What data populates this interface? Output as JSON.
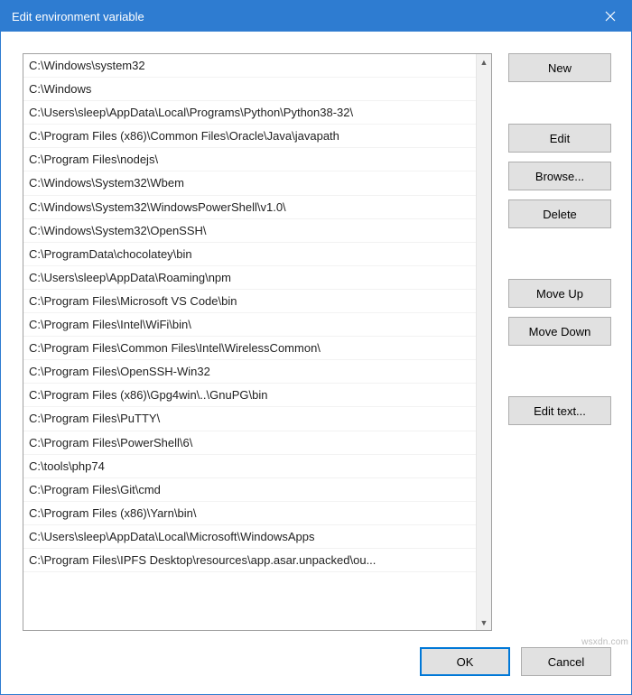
{
  "window": {
    "title": "Edit environment variable"
  },
  "list": {
    "items": [
      "C:\\Windows\\system32",
      "C:\\Windows",
      "C:\\Users\\sleep\\AppData\\Local\\Programs\\Python\\Python38-32\\",
      "C:\\Program Files (x86)\\Common Files\\Oracle\\Java\\javapath",
      "C:\\Program Files\\nodejs\\",
      "C:\\Windows\\System32\\Wbem",
      "C:\\Windows\\System32\\WindowsPowerShell\\v1.0\\",
      "C:\\Windows\\System32\\OpenSSH\\",
      "C:\\ProgramData\\chocolatey\\bin",
      "C:\\Users\\sleep\\AppData\\Roaming\\npm",
      "C:\\Program Files\\Microsoft VS Code\\bin",
      "C:\\Program Files\\Intel\\WiFi\\bin\\",
      "C:\\Program Files\\Common Files\\Intel\\WirelessCommon\\",
      "C:\\Program Files\\OpenSSH-Win32",
      "C:\\Program Files (x86)\\Gpg4win\\..\\GnuPG\\bin",
      "C:\\Program Files\\PuTTY\\",
      "C:\\Program Files\\PowerShell\\6\\",
      "C:\\tools\\php74",
      "C:\\Program Files\\Git\\cmd",
      "C:\\Program Files (x86)\\Yarn\\bin\\",
      "C:\\Users\\sleep\\AppData\\Local\\Microsoft\\WindowsApps",
      "C:\\Program Files\\IPFS Desktop\\resources\\app.asar.unpacked\\ou..."
    ]
  },
  "buttons": {
    "new": "New",
    "edit": "Edit",
    "browse": "Browse...",
    "delete": "Delete",
    "move_up": "Move Up",
    "move_down": "Move Down",
    "edit_text": "Edit text...",
    "ok": "OK",
    "cancel": "Cancel"
  },
  "watermark": "wsxdn.com"
}
